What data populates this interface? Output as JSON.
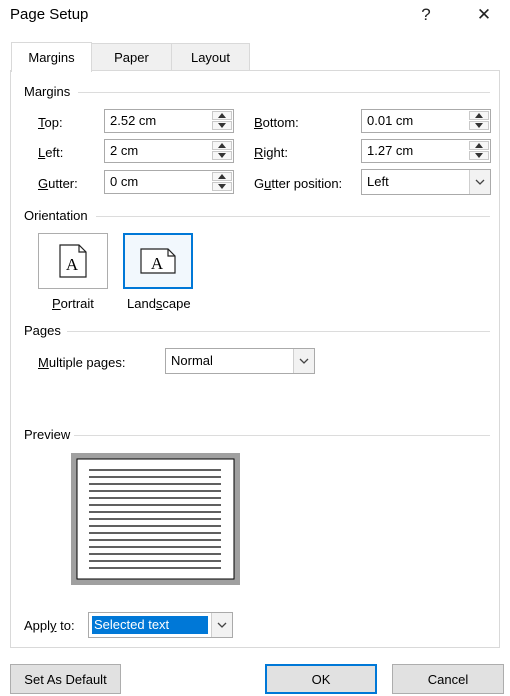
{
  "window": {
    "title": "Page Setup",
    "help": "?",
    "close": "✕"
  },
  "tabs": [
    {
      "label": "Margins"
    },
    {
      "label": "Paper"
    },
    {
      "label": "Layout"
    }
  ],
  "margins": {
    "section": "Margins",
    "top": {
      "prefix": "",
      "hot": "T",
      "rest": "op:",
      "value": "2.52 cm"
    },
    "left": {
      "hot": "L",
      "rest": "eft:",
      "value": "2 cm"
    },
    "gutter": {
      "hot": "G",
      "rest": "utter:",
      "value": "0 cm"
    },
    "bottom": {
      "hot": "B",
      "rest": "ottom:",
      "value": "0.01 cm"
    },
    "right": {
      "hot": "R",
      "rest": "ight:",
      "value": "1.27 cm"
    },
    "gutter_position": {
      "hot": "u",
      "pre": "G",
      "rest": "tter position:",
      "value": "Left"
    }
  },
  "orientation": {
    "section": "Orientation",
    "portrait": {
      "hot": "P",
      "rest": "ortrait"
    },
    "landscape": {
      "pre": "Land",
      "hot": "s",
      "rest": "cape"
    },
    "glyph": "A"
  },
  "pages": {
    "section": "Pages",
    "multiple_pages": {
      "hot": "M",
      "rest": "ultiple pages:",
      "value": "Normal"
    }
  },
  "preview": {
    "section": "Preview"
  },
  "apply_to": {
    "hot": "y",
    "pre": "Appl",
    "rest": " to:",
    "value": "Selected text"
  },
  "buttons": {
    "set_default": "Set As Default",
    "ok": "OK",
    "cancel": "Cancel"
  },
  "colors": {
    "accent": "#0078d7",
    "selection": "#0078d7"
  }
}
